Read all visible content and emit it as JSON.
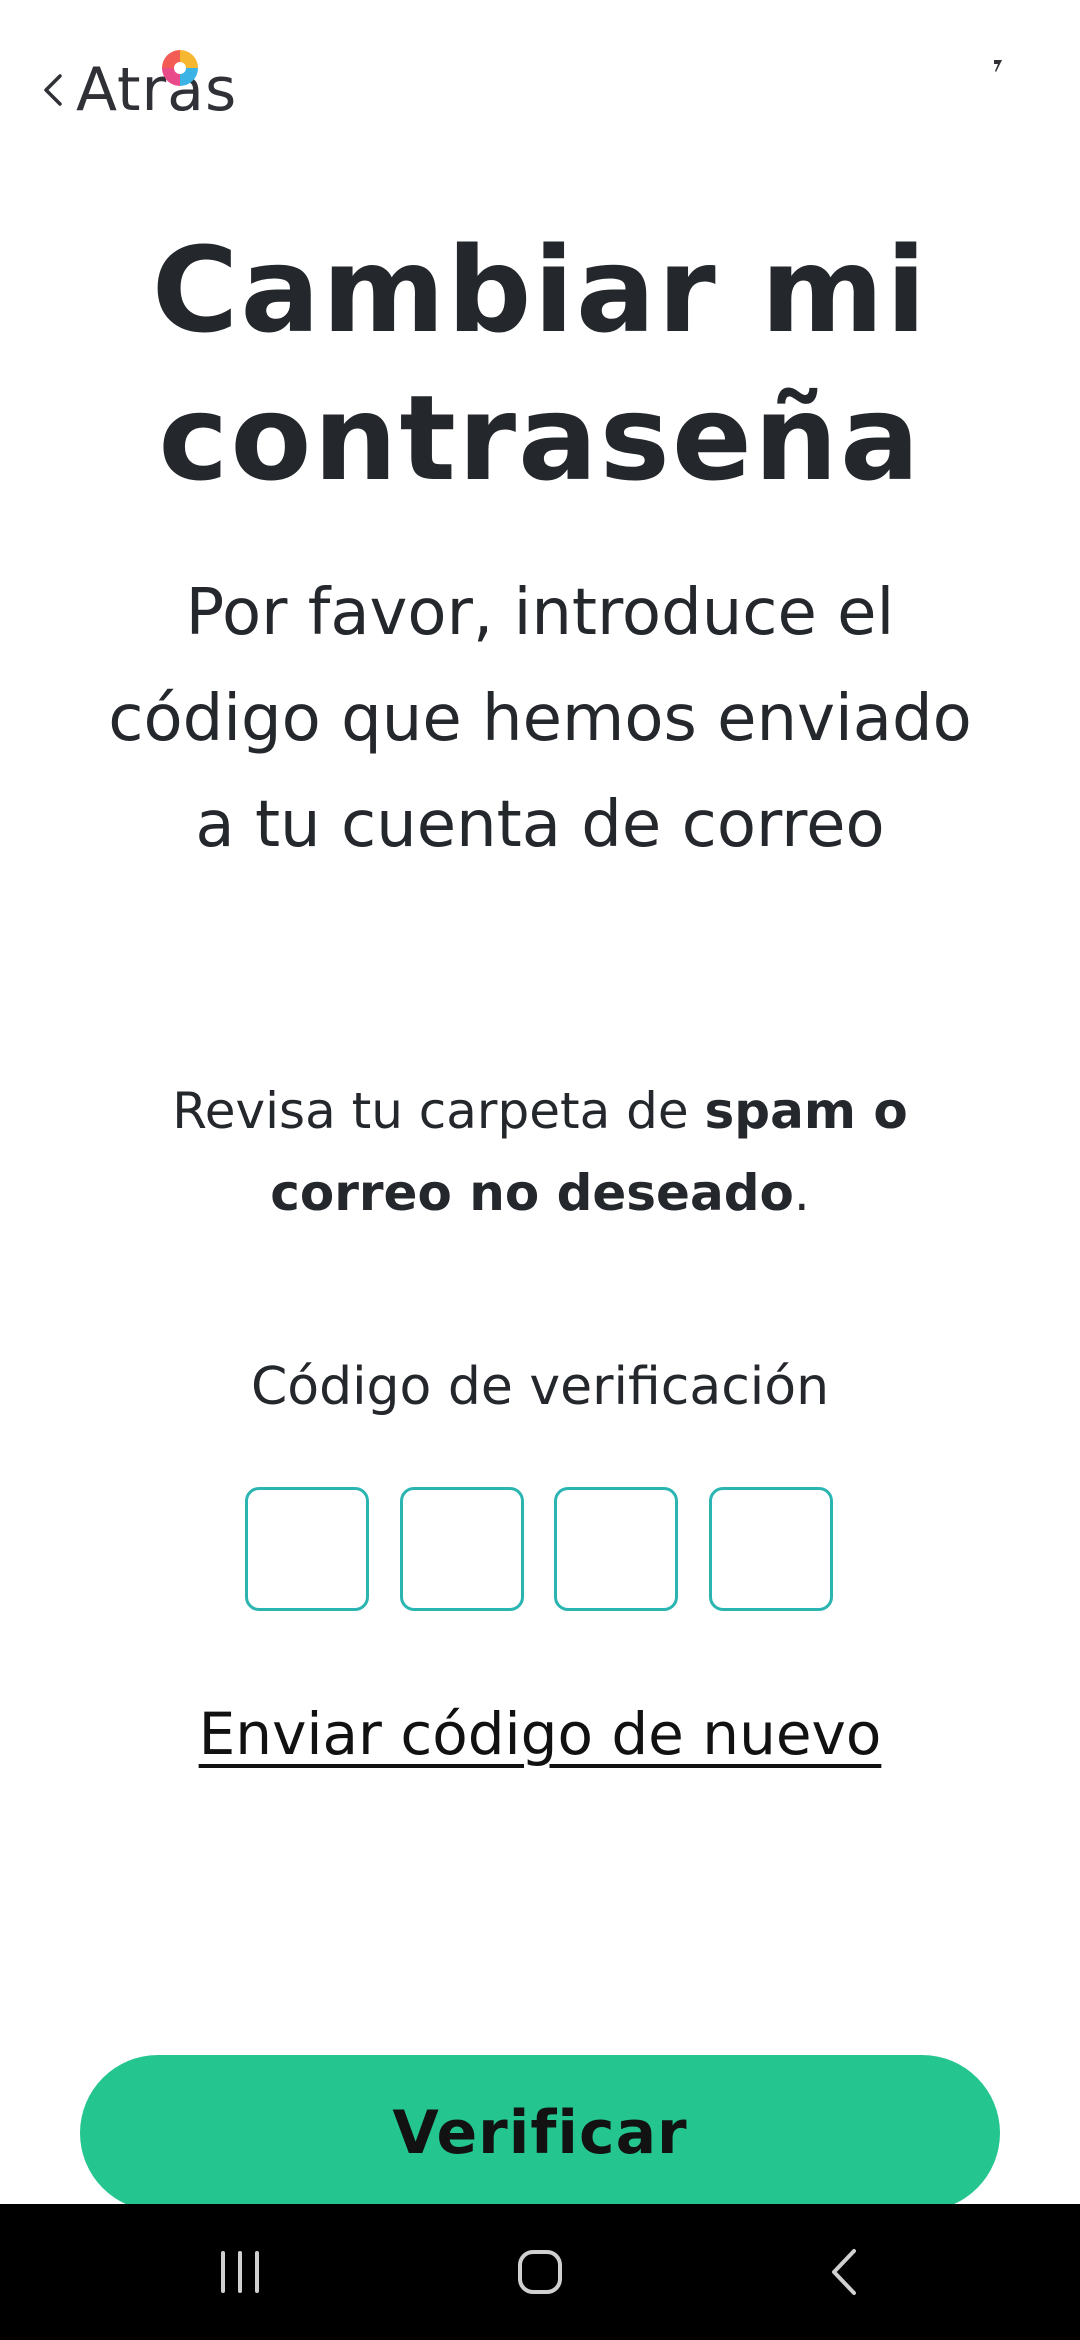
{
  "header": {
    "back_label": "Atrás",
    "back_icon": "chevron-left-icon",
    "logo_icon": "pinwheel-logo-icon",
    "logo_colors": [
      "#f25c54",
      "#f7b731",
      "#3bb4e5",
      "#e94b8a"
    ]
  },
  "page": {
    "title_line1": "Cambiar mi",
    "title_line2": "contraseña",
    "subtitle": "Por favor, introduce el código que hemos enviado a tu cuenta de correo",
    "spam_note_prefix": "Revisa tu carpeta de ",
    "spam_note_bold": "spam o correo no deseado",
    "spam_note_suffix": "."
  },
  "verification": {
    "label": "Código de verificación",
    "digits": [
      "",
      "",
      "",
      ""
    ],
    "box_border_color": "#2bb5b2"
  },
  "actions": {
    "resend_label": "Enviar código de nuevo",
    "verify_label": "Verificar",
    "verify_color": "#25c590"
  },
  "system_nav": {
    "recents_icon": "recents-icon",
    "home_icon": "home-icon",
    "back_icon": "back-icon"
  }
}
